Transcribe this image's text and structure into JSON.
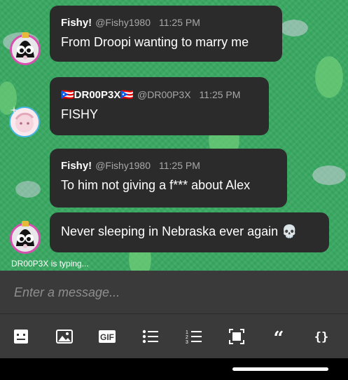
{
  "messages": [
    {
      "author": "Fishy!",
      "handle": "@Fishy1980",
      "time": "11:25 PM",
      "text": "From Droopi wanting to marry me",
      "avatar": "fishy-avatar"
    },
    {
      "author": "🇵🇷DR00P3X🇵🇷",
      "handle": "@DR00P3X",
      "time": "11:25 PM",
      "text": "FISHY",
      "avatar": "droop-avatar"
    },
    {
      "author": "Fishy!",
      "handle": "@Fishy1980",
      "time": "11:25 PM",
      "text": "To him not giving a f*** about Alex",
      "avatar": "fishy-avatar"
    },
    {
      "text": "Never sleeping in Nebraska ever again 💀",
      "avatar": "fishy-avatar"
    }
  ],
  "typing_indicator": "DR00P3X is typing...",
  "composer": {
    "placeholder": "Enter a message..."
  },
  "toolbar": {
    "items": [
      "emoji-icon",
      "image-icon",
      "gif-icon",
      "bullet-list-icon",
      "numbered-list-icon",
      "screenshot-icon",
      "quote-icon",
      "code-icon"
    ],
    "gif_label": "GIF",
    "quote_label": "“",
    "code_label": "{}"
  },
  "colors": {
    "bubble": "#2b2b2c",
    "chat_bg": "#3aa862",
    "composer_bg": "#3a3a3b",
    "fishy_ring": "#d94fb0",
    "droop_ring": "#4ab6e8"
  }
}
